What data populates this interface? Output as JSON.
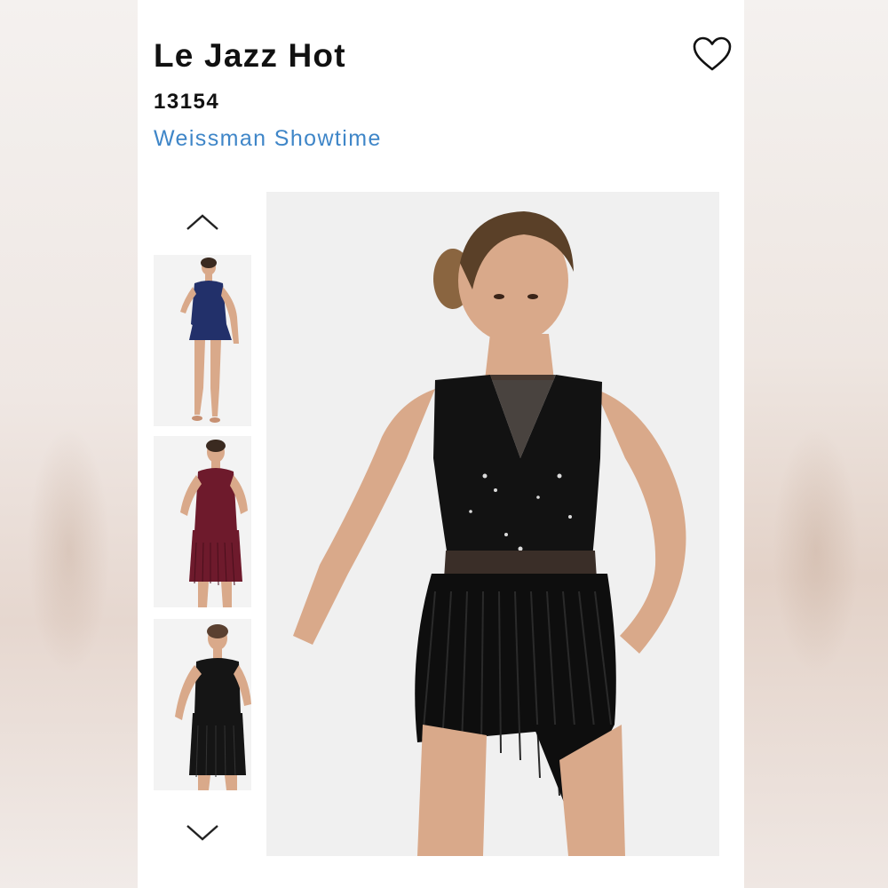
{
  "product": {
    "title": "Le Jazz Hot",
    "sku": "13154",
    "brand": "Weissman Showtime"
  },
  "actions": {
    "favorite_icon": "heart-outline-icon"
  },
  "gallery": {
    "scroll_up_icon": "chevron-up-icon",
    "scroll_down_icon": "chevron-down-icon",
    "thumbnails": [
      {
        "color_name": "navy",
        "costume_color": "#22306a"
      },
      {
        "color_name": "burgundy",
        "costume_color": "#6e1a2c"
      },
      {
        "color_name": "black",
        "costume_color": "#151515"
      }
    ],
    "main_image_color": "#121212"
  },
  "colors": {
    "brand_link": "#3f86c8",
    "text": "#111111",
    "skin": "#d9a98a"
  }
}
